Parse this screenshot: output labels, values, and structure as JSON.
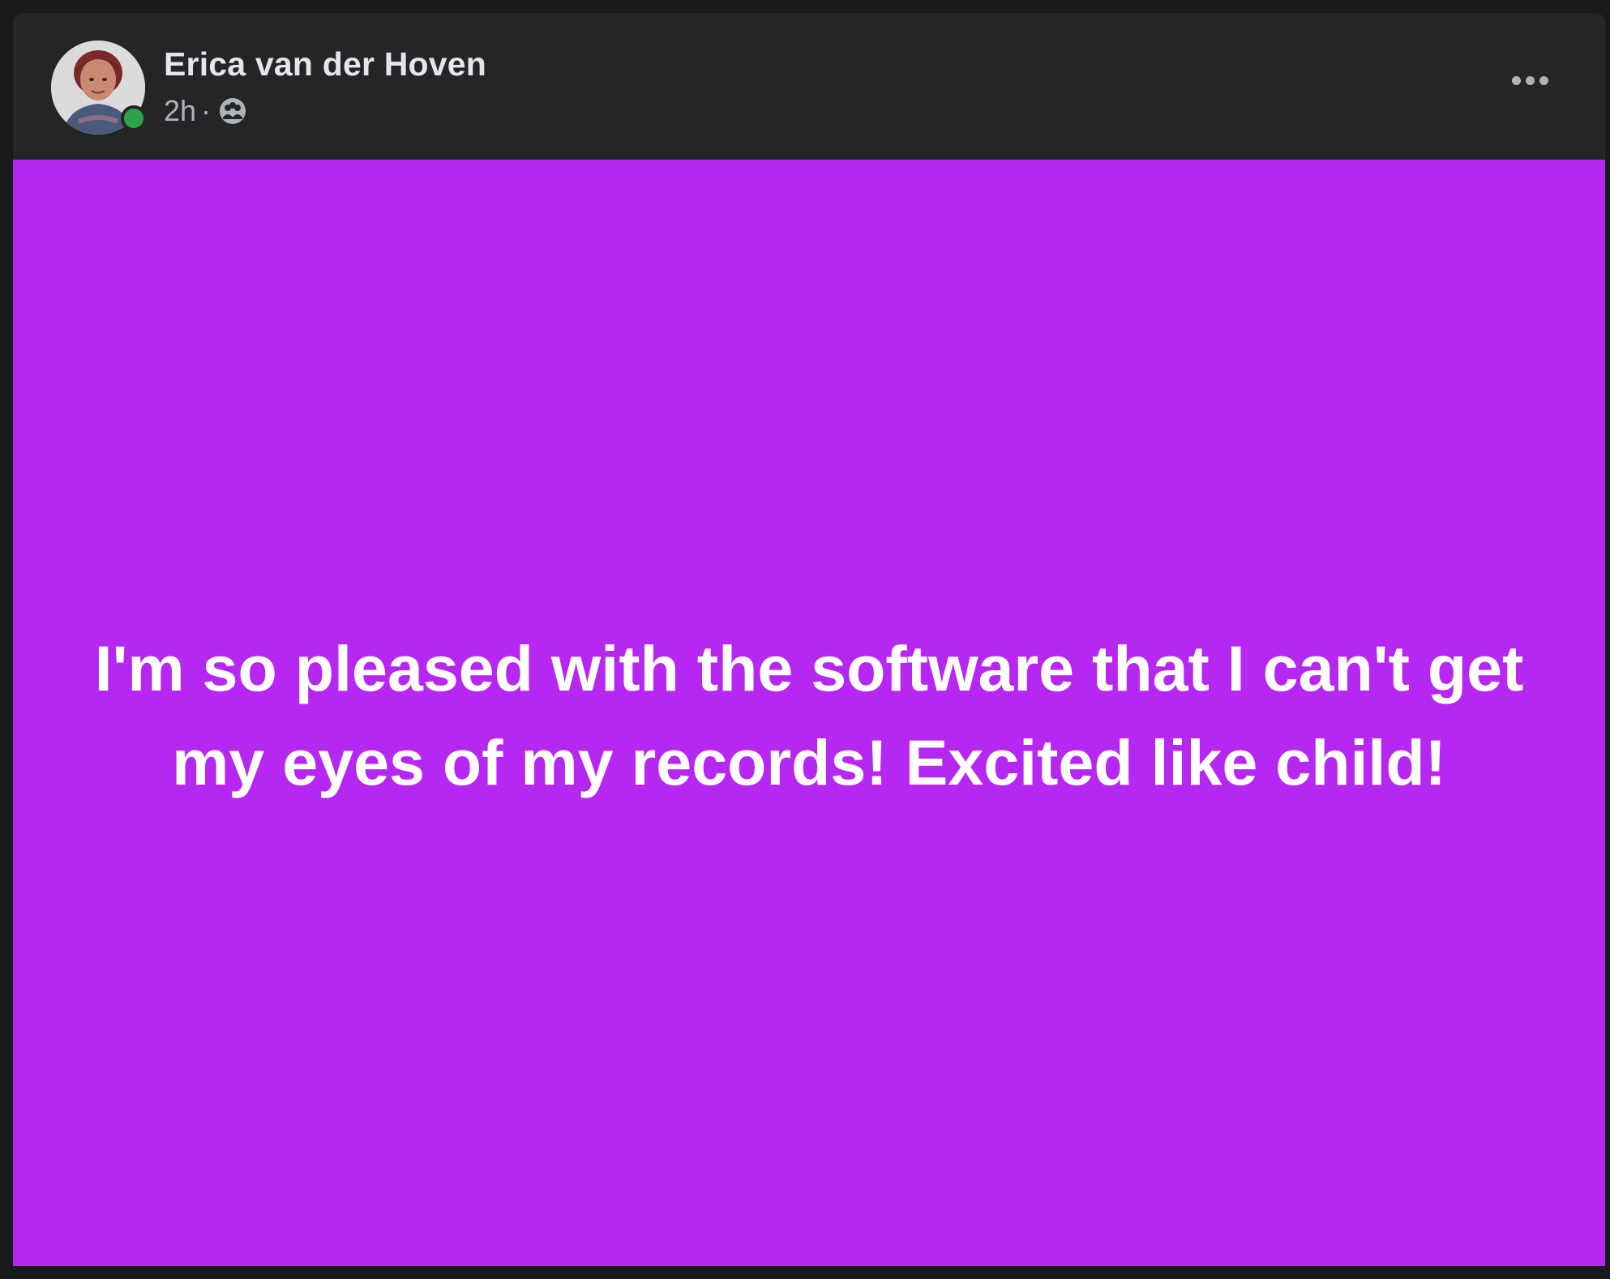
{
  "post": {
    "author_name": "Erica van der Hoven",
    "timestamp": "2h",
    "separator": "·",
    "audience_icon": "friends-icon",
    "online_status": "online",
    "more_icon": "more-options-icon",
    "text": "I'm so pleased with the software that I can't get my eyes of my records! Excited like child!",
    "background_color": "#b627f2",
    "text_color": "#ffffff",
    "online_color": "#31a24c"
  }
}
